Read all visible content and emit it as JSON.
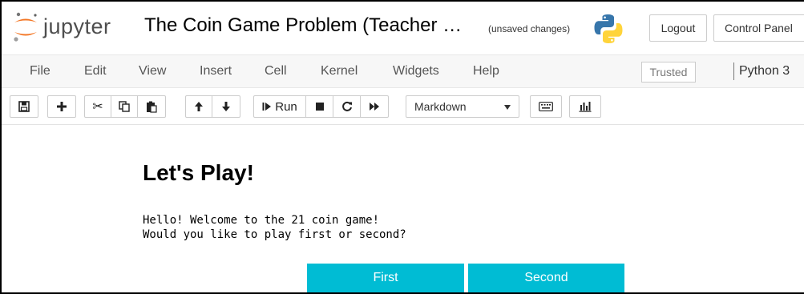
{
  "header": {
    "logo_text": "jupyter",
    "notebook_title": "The Coin Game Problem (Teacher …",
    "save_status": "(unsaved changes)",
    "logout_label": "Logout",
    "control_panel_label": "Control Panel"
  },
  "menubar": {
    "items": [
      "File",
      "Edit",
      "View",
      "Insert",
      "Cell",
      "Kernel",
      "Widgets",
      "Help"
    ],
    "trusted_label": "Trusted",
    "kernel_name": "Python 3"
  },
  "toolbar": {
    "run_label": "Run",
    "cell_type": "Markdown",
    "icons": [
      "save-icon",
      "plus-icon",
      "cut-icon",
      "copy-icon",
      "paste-icon",
      "arrow-up-icon",
      "arrow-down-icon",
      "run-icon",
      "stop-icon",
      "restart-icon",
      "fast-forward-icon",
      "keyboard-icon",
      "bar-chart-icon"
    ]
  },
  "notebook": {
    "heading": "Let's Play!",
    "output_line_1": "Hello! Welcome to the 21 coin game!",
    "output_line_2": "Would you like to play first or second?",
    "first_button": "First",
    "second_button": "Second"
  },
  "colors": {
    "accent_button": "#00bcd4",
    "jupyter_orange": "#f37726",
    "python_blue": "#3776ab",
    "python_yellow": "#ffd43b"
  }
}
